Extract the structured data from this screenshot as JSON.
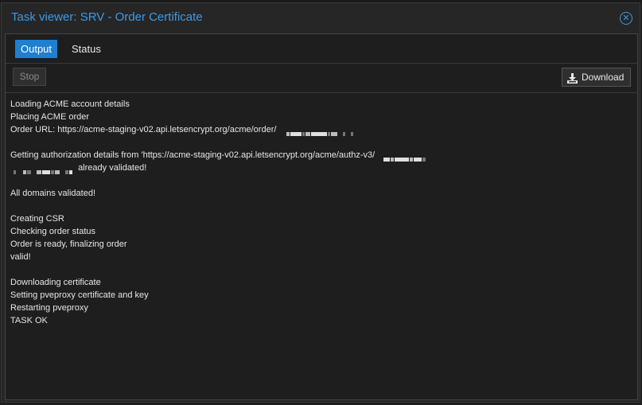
{
  "window": {
    "title": "Task viewer: SRV - Order Certificate",
    "close_icon": "close-circle-icon"
  },
  "tabs": [
    {
      "label": "Output",
      "active": true
    },
    {
      "label": "Status",
      "active": false
    }
  ],
  "toolbar": {
    "stop_label": "Stop",
    "stop_enabled": false,
    "download_label": "Download",
    "download_icon": "download-icon"
  },
  "log": {
    "line_1": "Loading ACME account details",
    "line_2": "Placing ACME order",
    "line_3": "Order URL: https://acme-staging-v02.api.letsencrypt.org/acme/order/",
    "line_5": "Getting authorization details from 'https://acme-staging-v02.api.letsencrypt.org/acme/authz-v3/",
    "line_6": "already validated!",
    "line_8": "All domains validated!",
    "line_10": "Creating CSR",
    "line_11": "Checking order status",
    "line_12": "Order is ready, finalizing order",
    "line_13": "valid!",
    "line_15": "Downloading certificate",
    "line_16": "Setting pveproxy certificate and key",
    "line_17": "Restarting pveproxy",
    "line_18": "TASK OK"
  },
  "colors": {
    "accent": "#3d9ae8",
    "active_tab": "#1f7fd0",
    "background": "#1e1e1e",
    "text": "#e6e6e6"
  }
}
